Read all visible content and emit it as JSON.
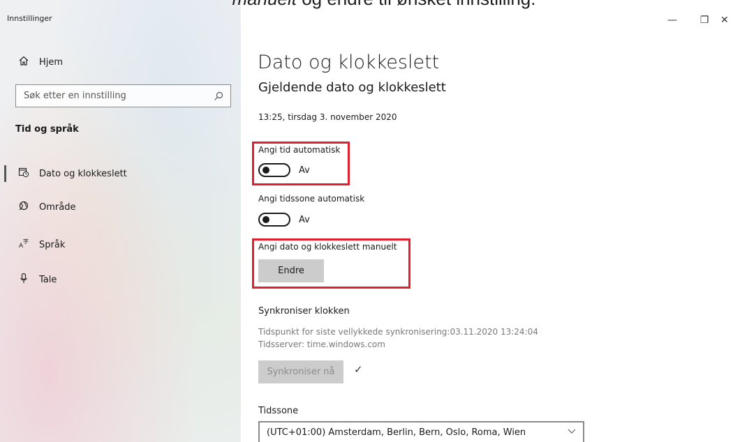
{
  "banner": {
    "italic_text": "manuelt",
    "text": " og endre til ønsket innstilling."
  },
  "window": {
    "title": "Innstillinger",
    "controls": {
      "minimize": "—",
      "restore": "❐",
      "close": "✕"
    }
  },
  "sidebar": {
    "home_label": "Hjem",
    "search": {
      "placeholder": "Søk etter en innstilling"
    },
    "section": "Tid og språk",
    "items": [
      {
        "label": "Dato og klokkeslett",
        "icon": "calendar-clock-icon",
        "active": true
      },
      {
        "label": "Område",
        "icon": "globe-icon",
        "active": false
      },
      {
        "label": "Språk",
        "icon": "language-icon",
        "active": false
      },
      {
        "label": "Tale",
        "icon": "microphone-icon",
        "active": false
      }
    ]
  },
  "main": {
    "title": "Dato og klokkeslett",
    "subtitle": "Gjeldende dato og klokkeslett",
    "current_datetime": "13:25, tirsdag 3. november 2020",
    "auto_time": {
      "label": "Angi tid automatisk",
      "state": "Av",
      "on": false
    },
    "auto_timezone": {
      "label": "Angi tidssone automatisk",
      "state": "Av",
      "on": false
    },
    "manual": {
      "label": "Angi dato og klokkeslett manuelt",
      "button": "Endre"
    },
    "sync": {
      "heading": "Synkroniser klokken",
      "last_sync": "Tidspunkt for siste vellykkede synkronisering:03.11.2020 13:24:04",
      "server": "Tidsserver: time.windows.com",
      "button": "Synkroniser nå"
    },
    "timezone": {
      "heading": "Tidssone",
      "value": "(UTC+01:00) Amsterdam, Berlin, Bern, Oslo, Roma, Wien"
    }
  },
  "colors": {
    "highlight": "#e0202e",
    "button_bg": "#cccccc"
  }
}
